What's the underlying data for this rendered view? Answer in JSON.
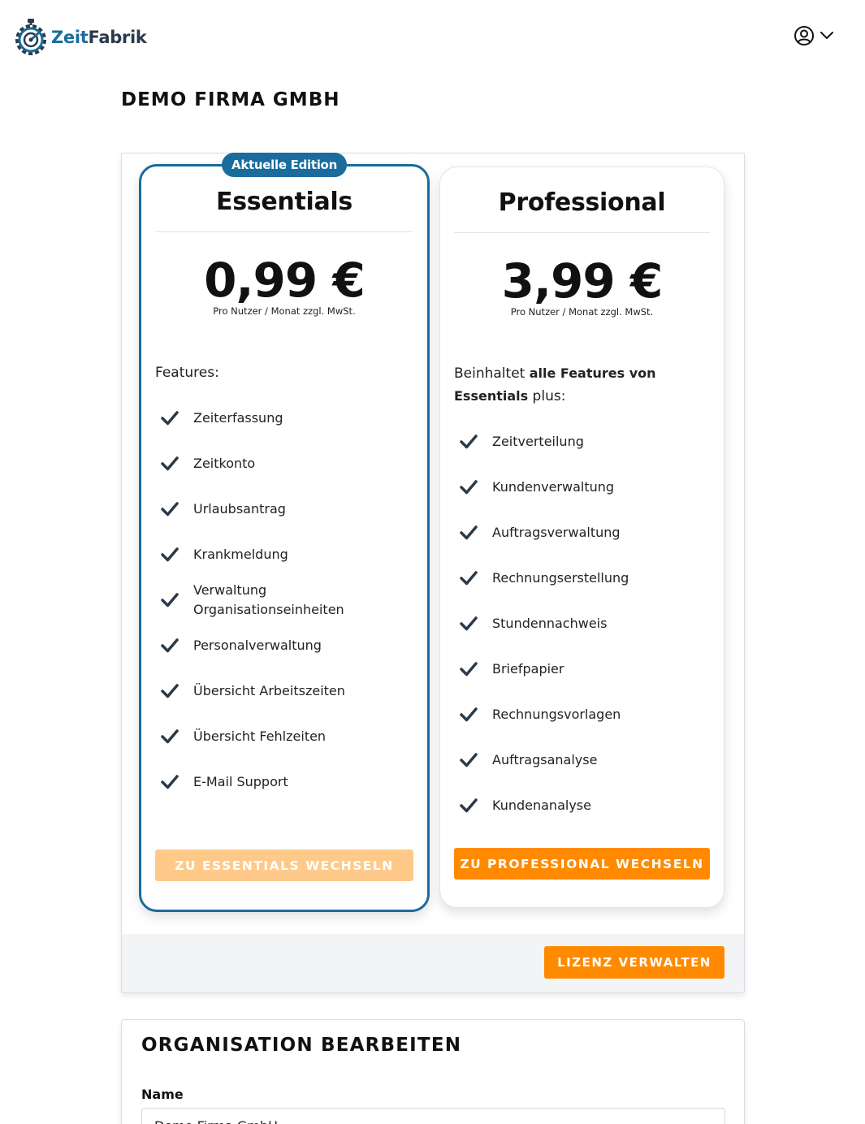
{
  "header": {
    "logo_zeit": "Zeit",
    "logo_fabrik": "Fabrik",
    "user_icon": "user-circle-icon",
    "menu_icon": "chevron-down-icon"
  },
  "page": {
    "title": "DEMO FIRMA GMBH"
  },
  "plans": [
    {
      "badge": "Aktuelle Edition",
      "name": "Essentials",
      "price": "0,99 €",
      "price_note": "Pro Nutzer / Monat zzgl. MwSt.",
      "features_title": "Features:",
      "features": [
        "Zeiterfassung",
        "Zeitkonto",
        "Urlaubsantrag",
        "Krankmeldung",
        "Verwaltung Organisationseinheiten",
        "Personalverwaltung",
        "Übersicht Arbeitszeiten",
        "Übersicht Fehlzeiten",
        "E-Mail Support"
      ],
      "button": "ZU ESSENTIALS WECHSELN"
    },
    {
      "name": "Professional",
      "price": "3,99 €",
      "price_note": "Pro Nutzer / Monat zzgl. MwSt.",
      "features_title_pre": "Beinhaltet ",
      "features_title_bold": "alle Features von Essentials",
      "features_title_post": " plus:",
      "features": [
        "Zeitverteilung",
        "Kundenverwaltung",
        "Auftragsverwaltung",
        "Rechnungserstellung",
        "Stundennachweis",
        "Briefpapier",
        "Rechnungsvorlagen",
        "Auftragsanalyse",
        "Kundenanalyse"
      ],
      "button": "ZU PROFESSIONAL WECHSELN"
    }
  ],
  "licence": {
    "manage_button": "LIZENZ VERWALTEN"
  },
  "organisation": {
    "title": "ORGANISATION BEARBEITEN",
    "name_label": "Name",
    "name_value": "Demo Firma GmbH"
  },
  "colors": {
    "brand_blue": "#1a6c9c",
    "accent_orange": "#ff8a00",
    "disabled_orange": "#ffc98a"
  }
}
